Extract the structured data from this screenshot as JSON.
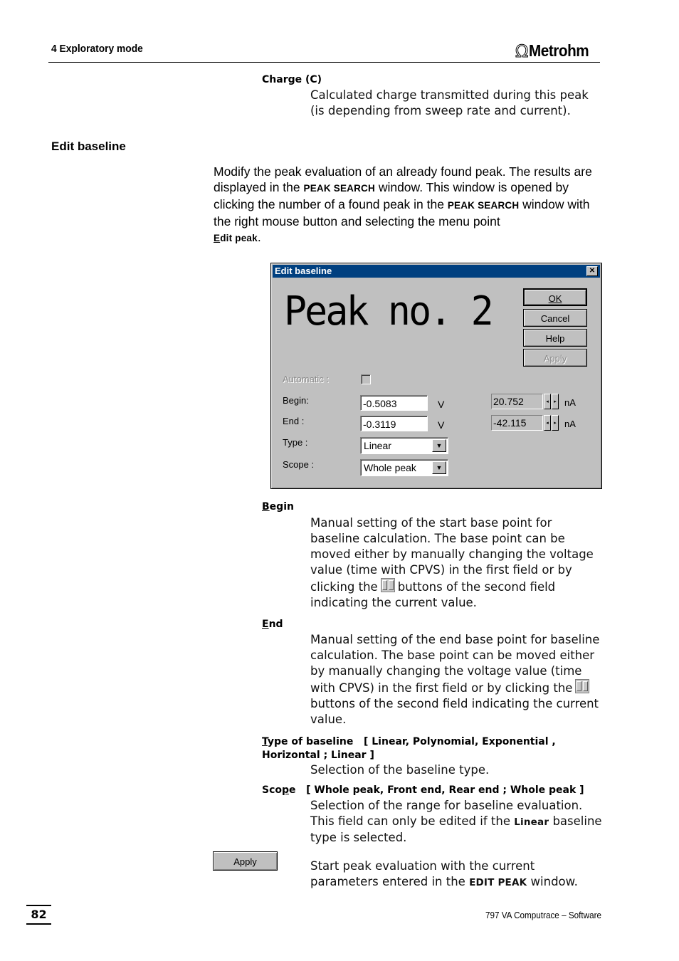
{
  "header": {
    "chapter": "4  Exploratory mode",
    "logo_text": "Metrohm",
    "logo_icon": "omega-icon"
  },
  "charge": {
    "term": "Charge (C)",
    "description": "Calculated charge transmitted during this peak (is depending from sweep rate and current)."
  },
  "section": {
    "title": "Edit baseline",
    "intro_1": "Modify the peak evaluation of an already found peak. The results are displayed in the ",
    "intro_sc1": "PEAK SEARCH",
    "intro_2": " window. This window is opened by clicking the number of a found peak in the ",
    "intro_sc2": "PEAK SEARCH",
    "intro_3": " window with the right mouse button and selecting the menu point ",
    "intro_menu_first": "E",
    "intro_menu_rest": "dit peak",
    "intro_end": "."
  },
  "dialog": {
    "title": "Edit baseline",
    "heading": "Peak no. 2",
    "buttons": {
      "ok": "OK",
      "cancel": "Cancel",
      "help": "Help",
      "apply": "Apply"
    },
    "automatic_label": "Automatic :",
    "automatic_checked": false,
    "begin_label": "Begin:",
    "begin_value": "-0.5083",
    "begin_unit": "V",
    "begin_current": "20.752",
    "end_label": "End :",
    "end_value": "-0.3119",
    "end_unit": "V",
    "end_current": "-42.115",
    "current_unit": "nA",
    "type_label": "Type :",
    "type_value": "Linear",
    "scope_label": "Scope :",
    "scope_value": "Whole peak"
  },
  "params": {
    "begin": {
      "term_first": "B",
      "term_rest": "egin",
      "text_1": "Manual setting of the start base point for baseline calculation. The base point can be moved either by manually changing the voltage value (time with CPVS) in the first field or by clicking the",
      "text_2": "buttons of the second field indicating the current value."
    },
    "end": {
      "term_first": "E",
      "term_rest": "nd",
      "text_1": "Manual setting of the end base point for baseline calculation. The base point can be moved either by manually changing the voltage value (time with CPVS) in the first field or by clicking the",
      "text_2": "buttons of the second field indicating the current value."
    },
    "type": {
      "term_first": "T",
      "term_rest": "ype of baseline",
      "options": "[ Linear, Polynomial, Exponential , Horizontal ; Linear ]",
      "text": "Selection of the baseline type."
    },
    "scope": {
      "term_a": "Sco",
      "term_u": "p",
      "term_b": "e",
      "options": "[ Whole peak, Front end, Rear end ; Whole peak ]",
      "text_1": "Selection of the range for baseline evaluation. This field can only be edited if the ",
      "text_sc": "Linear",
      "text_2": " baseline type is selected."
    },
    "apply": {
      "button": "Apply",
      "text_1": "Start peak evaluation with the current parameters entered in the ",
      "text_sc": "EDIT PEAK",
      "text_2": " window."
    }
  },
  "footer": {
    "page_number": "82",
    "product": "797 VA Computrace – Software"
  }
}
